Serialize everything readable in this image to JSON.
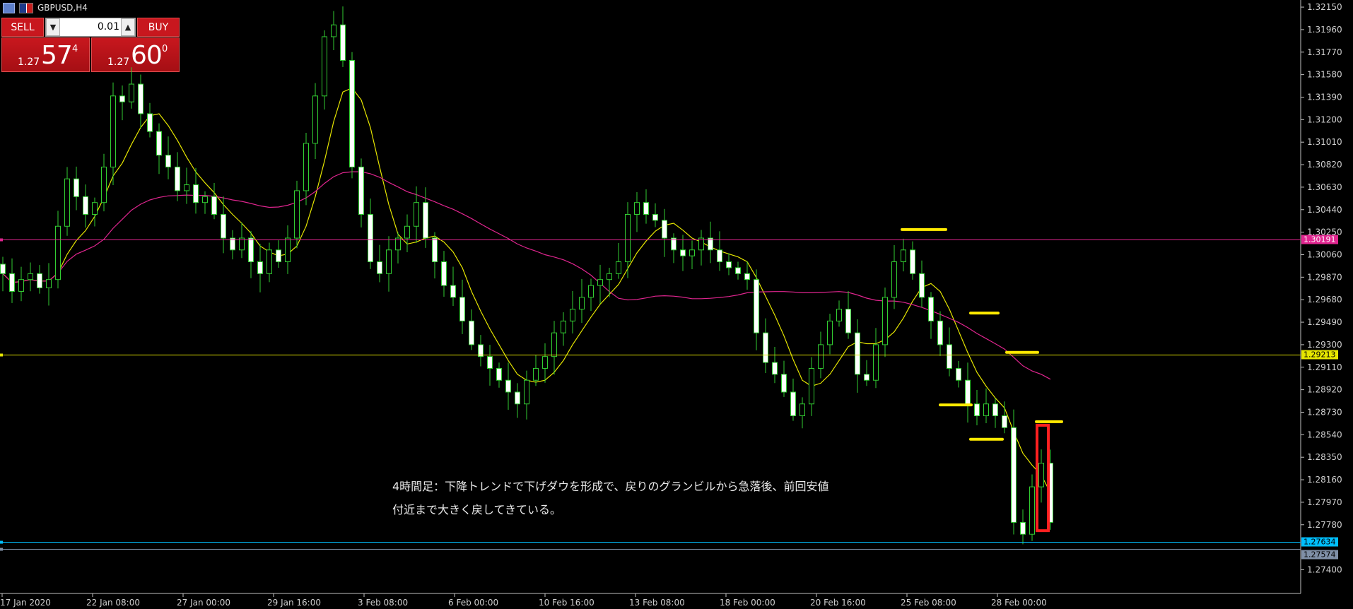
{
  "window": {
    "symbol_label": "GBPUSD,H4"
  },
  "trade_panel": {
    "sell_label": "SELL",
    "buy_label": "BUY",
    "lot_value": "0.01",
    "lot_down_glyph": "▼",
    "lot_up_glyph": "▲",
    "sell_price_prefix": "1.27",
    "sell_price_big": "57",
    "sell_price_sup": "4",
    "buy_price_prefix": "1.27",
    "buy_price_big": "60",
    "buy_price_sup": "0"
  },
  "price_axis": {
    "labels": [
      "1.32150",
      "1.31960",
      "1.31770",
      "1.31580",
      "1.31390",
      "1.31200",
      "1.31010",
      "1.30820",
      "1.30630",
      "1.30440",
      "1.30250",
      "1.30060",
      "1.29870",
      "1.29680",
      "1.29490",
      "1.29300",
      "1.29110",
      "1.28920",
      "1.28730",
      "1.28540",
      "1.28350",
      "1.28160",
      "1.27970",
      "1.27780",
      "1.27400"
    ]
  },
  "time_axis": {
    "labels": [
      "17 Jan 2020",
      "22 Jan 08:00",
      "27 Jan 00:00",
      "29 Jan 16:00",
      "3 Feb 08:00",
      "6 Feb 00:00",
      "10 Feb 16:00",
      "13 Feb 08:00",
      "18 Feb 00:00",
      "20 Feb 16:00",
      "25 Feb 08:00",
      "28 Feb 00:00"
    ]
  },
  "horizontal_lines": [
    {
      "label": "1.30191",
      "price": 1.30191,
      "color": "#e0258f",
      "text_color": "#ffffff"
    },
    {
      "label": "1.29213",
      "price": 1.29213,
      "color": "#e6e600",
      "text_color": "#000000"
    },
    {
      "label": "1.27634",
      "price": 1.27634,
      "color": "#00bfff",
      "text_color": "#000000"
    },
    {
      "label": "1.27574",
      "price": 1.27574,
      "color": "#7f8fa6",
      "text_color": "#000000"
    }
  ],
  "annotation": {
    "line1": "4時間足：下降トレンドで下げダウを形成で、戻りのグランビルから急落後、前回安値",
    "line2": "付近まで大きく戻してきている。"
  },
  "colors": {
    "background": "#000000",
    "candle": "#32cd32",
    "candle_bull_fill": "#000000",
    "candle_bear_fill": "#ffffff",
    "ma_fast": "#e6e600",
    "ma_slow": "#e0258f",
    "marker": "#ffea00",
    "highlight_box": "#ff2020",
    "axis": "#c0c0c0"
  },
  "chart_data": {
    "type": "candlestick",
    "symbol": "GBPUSD",
    "timeframe": "H4",
    "ylim": [
      1.272,
      1.322
    ],
    "close_series": [
      1.299,
      1.2975,
      1.2985,
      1.299,
      1.2978,
      1.2985,
      1.303,
      1.307,
      1.3055,
      1.304,
      1.305,
      1.308,
      1.314,
      1.3135,
      1.315,
      1.3125,
      1.311,
      1.309,
      1.308,
      1.306,
      1.3065,
      1.305,
      1.3055,
      1.304,
      1.302,
      1.301,
      1.302,
      1.3,
      1.299,
      1.301,
      1.3,
      1.302,
      1.306,
      1.31,
      1.314,
      1.319,
      1.32,
      1.317,
      1.308,
      1.304,
      1.3,
      1.299,
      1.301,
      1.302,
      1.303,
      1.305,
      1.302,
      1.3,
      1.298,
      1.297,
      1.295,
      1.293,
      1.292,
      1.291,
      1.29,
      1.289,
      1.288,
      1.29,
      1.291,
      1.292,
      1.294,
      1.295,
      1.296,
      1.297,
      1.298,
      1.2985,
      1.299,
      1.3,
      1.304,
      1.305,
      1.304,
      1.3035,
      1.302,
      1.301,
      1.3005,
      1.301,
      1.302,
      1.301,
      1.3,
      1.2995,
      1.299,
      1.2985,
      1.294,
      1.2915,
      1.2905,
      1.289,
      1.287,
      1.288,
      1.291,
      1.293,
      1.295,
      1.296,
      1.294,
      1.2905,
      1.29,
      1.293,
      1.297,
      1.3,
      1.301,
      1.299,
      1.297,
      1.295,
      1.293,
      1.291,
      1.29,
      1.288,
      1.287,
      1.288,
      1.287,
      1.286,
      1.278,
      1.277,
      1.281,
      1.283,
      1.278
    ]
  }
}
